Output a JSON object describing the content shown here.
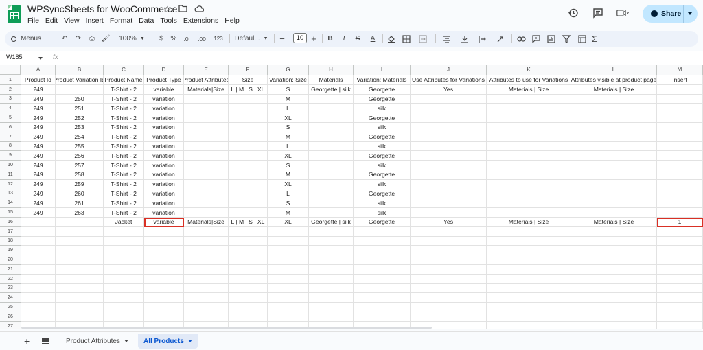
{
  "app": {
    "title": "WPSyncSheets for WooCommerce",
    "menu": [
      "File",
      "Edit",
      "View",
      "Insert",
      "Format",
      "Data",
      "Tools",
      "Extensions",
      "Help"
    ],
    "share_label": "Share",
    "title_icons": [
      "star-icon",
      "move-folder-icon",
      "cloud-status-icon"
    ],
    "right_icons": [
      "version-history-icon",
      "comment-icon",
      "meet-icon"
    ]
  },
  "toolbar": {
    "search_label": "Menus",
    "zoom": "100%",
    "currency": "$",
    "percent": "%",
    "dec_decrease": ".0",
    "dec_increase": ".00",
    "number_format": "123",
    "font": "Defaul...",
    "font_size": "10",
    "bold": "B",
    "italic": "I",
    "strike": "S",
    "text_color": "A",
    "sum": "Σ"
  },
  "formula_bar": {
    "name_box": "W185",
    "fx": "fx",
    "value": ""
  },
  "columns": [
    "A",
    "B",
    "C",
    "D",
    "E",
    "F",
    "G",
    "H",
    "I",
    "J",
    "K",
    "L",
    "M"
  ],
  "rows": [
    {
      "n": "1",
      "cells": [
        "Product Id",
        "Product Variation Id",
        "Product Name",
        "Product Type",
        "Product Attributes",
        "Size",
        "Variation: Size",
        "Materials",
        "Variation: Materials",
        "Use Attributes for Variations",
        "Attributes to use for Variations",
        "Attributes visible at product page",
        "Insert"
      ]
    },
    {
      "n": "2",
      "cells": [
        "249",
        "",
        "T-Shirt - 2",
        "variable",
        "Materials|Size",
        "L | M | S | XL",
        "S",
        "Georgette | silk",
        "Georgette",
        "Yes",
        "Materials | Size",
        "Materials | Size",
        ""
      ]
    },
    {
      "n": "3",
      "cells": [
        "249",
        "250",
        "T-Shirt - 2",
        "variation",
        "",
        "",
        "M",
        "",
        "Georgette",
        "",
        "",
        "",
        ""
      ]
    },
    {
      "n": "4",
      "cells": [
        "249",
        "251",
        "T-Shirt - 2",
        "variation",
        "",
        "",
        "L",
        "",
        "silk",
        "",
        "",
        "",
        ""
      ]
    },
    {
      "n": "5",
      "cells": [
        "249",
        "252",
        "T-Shirt - 2",
        "variation",
        "",
        "",
        "XL",
        "",
        "Georgette",
        "",
        "",
        "",
        ""
      ]
    },
    {
      "n": "6",
      "cells": [
        "249",
        "253",
        "T-Shirt - 2",
        "variation",
        "",
        "",
        "S",
        "",
        "silk",
        "",
        "",
        "",
        ""
      ]
    },
    {
      "n": "7",
      "cells": [
        "249",
        "254",
        "T-Shirt - 2",
        "variation",
        "",
        "",
        "M",
        "",
        "Georgette",
        "",
        "",
        "",
        ""
      ]
    },
    {
      "n": "8",
      "cells": [
        "249",
        "255",
        "T-Shirt - 2",
        "variation",
        "",
        "",
        "L",
        "",
        "silk",
        "",
        "",
        "",
        ""
      ]
    },
    {
      "n": "9",
      "cells": [
        "249",
        "256",
        "T-Shirt - 2",
        "variation",
        "",
        "",
        "XL",
        "",
        "Georgette",
        "",
        "",
        "",
        ""
      ]
    },
    {
      "n": "10",
      "cells": [
        "249",
        "257",
        "T-Shirt - 2",
        "variation",
        "",
        "",
        "S",
        "",
        "silk",
        "",
        "",
        "",
        ""
      ]
    },
    {
      "n": "11",
      "cells": [
        "249",
        "258",
        "T-Shirt - 2",
        "variation",
        "",
        "",
        "M",
        "",
        "Georgette",
        "",
        "",
        "",
        ""
      ]
    },
    {
      "n": "12",
      "cells": [
        "249",
        "259",
        "T-Shirt - 2",
        "variation",
        "",
        "",
        "XL",
        "",
        "silk",
        "",
        "",
        "",
        ""
      ]
    },
    {
      "n": "13",
      "cells": [
        "249",
        "260",
        "T-Shirt - 2",
        "variation",
        "",
        "",
        "L",
        "",
        "Georgette",
        "",
        "",
        "",
        ""
      ]
    },
    {
      "n": "14",
      "cells": [
        "249",
        "261",
        "T-Shirt - 2",
        "variation",
        "",
        "",
        "S",
        "",
        "silk",
        "",
        "",
        "",
        ""
      ]
    },
    {
      "n": "15",
      "cells": [
        "249",
        "263",
        "T-Shirt - 2",
        "variation",
        "",
        "",
        "M",
        "",
        "silk",
        "",
        "",
        "",
        ""
      ]
    },
    {
      "n": "16",
      "cells": [
        "",
        "",
        "Jacket",
        "variable",
        "Materials|Size",
        "L | M | S | XL",
        "XL",
        "Georgette | silk",
        "Georgette",
        "Yes",
        "Materials | Size",
        "Materials | Size",
        "1"
      ],
      "highlight": [
        "D",
        "M"
      ]
    },
    {
      "n": "17",
      "cells": []
    },
    {
      "n": "18",
      "cells": []
    },
    {
      "n": "19",
      "cells": []
    },
    {
      "n": "20",
      "cells": []
    },
    {
      "n": "21",
      "cells": []
    },
    {
      "n": "22",
      "cells": []
    },
    {
      "n": "23",
      "cells": []
    },
    {
      "n": "24",
      "cells": []
    },
    {
      "n": "25",
      "cells": []
    },
    {
      "n": "26",
      "cells": []
    },
    {
      "n": "27",
      "cells": []
    }
  ],
  "sheet_tabs": [
    {
      "label": "Product Attributes",
      "active": false
    },
    {
      "label": "All Products",
      "active": true
    }
  ],
  "colors": {
    "accent": "#0b57d0",
    "share_bg": "#c2e7ff",
    "highlight_border": "#d93025",
    "logo": "#0f9d58"
  }
}
